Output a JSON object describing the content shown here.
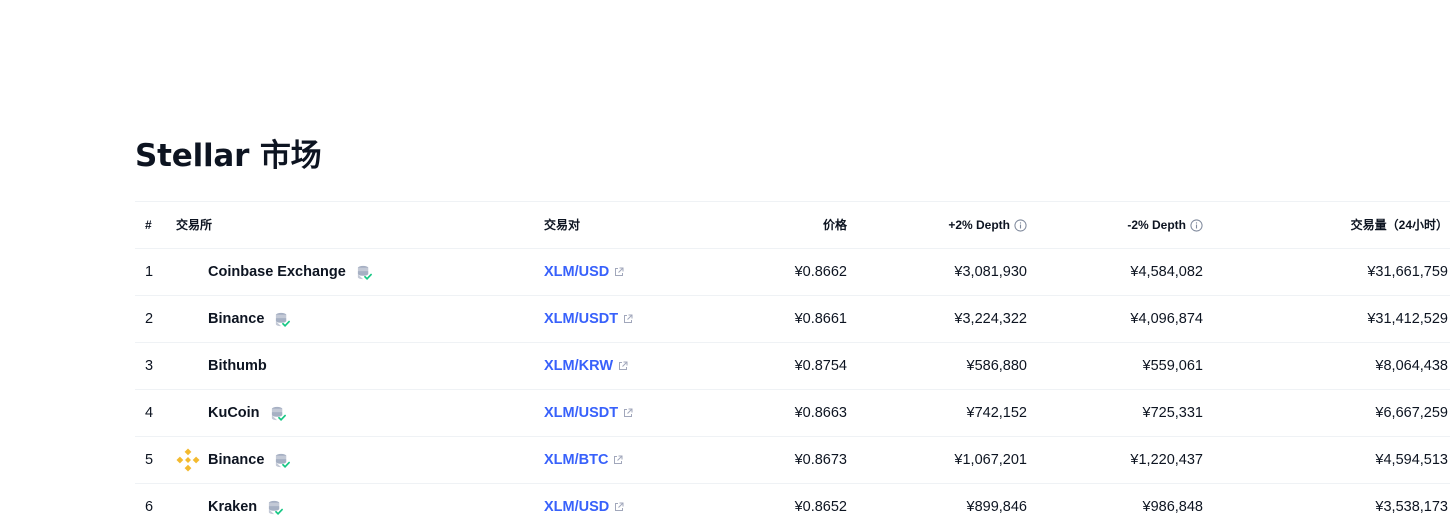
{
  "page": {
    "title": "Stellar 市场"
  },
  "table": {
    "headers": {
      "rank": "#",
      "exchange": "交易所",
      "pair": "交易对",
      "price": "价格",
      "plus_depth": "+2% Depth",
      "minus_depth": "-2% Depth",
      "volume": "交易量（24小时）"
    },
    "rows": [
      {
        "rank": "1",
        "exchange": "Coinbase Exchange",
        "verified": true,
        "logo": "",
        "pair": "XLM/USD",
        "price": "¥0.8662",
        "plus_depth": "¥3,081,930",
        "minus_depth": "¥4,584,082",
        "volume": "¥31,661,759"
      },
      {
        "rank": "2",
        "exchange": "Binance",
        "verified": true,
        "logo": "",
        "pair": "XLM/USDT",
        "price": "¥0.8661",
        "plus_depth": "¥3,224,322",
        "minus_depth": "¥4,096,874",
        "volume": "¥31,412,529"
      },
      {
        "rank": "3",
        "exchange": "Bithumb",
        "verified": false,
        "logo": "",
        "pair": "XLM/KRW",
        "price": "¥0.8754",
        "plus_depth": "¥586,880",
        "minus_depth": "¥559,061",
        "volume": "¥8,064,438"
      },
      {
        "rank": "4",
        "exchange": "KuCoin",
        "verified": true,
        "logo": "",
        "pair": "XLM/USDT",
        "price": "¥0.8663",
        "plus_depth": "¥742,152",
        "minus_depth": "¥725,331",
        "volume": "¥6,667,259"
      },
      {
        "rank": "5",
        "exchange": "Binance",
        "verified": true,
        "logo": "binance-logo",
        "pair": "XLM/BTC",
        "price": "¥0.8673",
        "plus_depth": "¥1,067,201",
        "minus_depth": "¥1,220,437",
        "volume": "¥4,594,513"
      },
      {
        "rank": "6",
        "exchange": "Kraken",
        "verified": true,
        "logo": "",
        "pair": "XLM/USD",
        "price": "¥0.8652",
        "plus_depth": "¥899,846",
        "minus_depth": "¥986,848",
        "volume": "¥3,538,173"
      }
    ]
  },
  "colors": {
    "link": "#3861fb",
    "text": "#0d1421",
    "divider": "#eff2f5",
    "verified_check": "#16c784",
    "binance": "#f3ba2f"
  }
}
